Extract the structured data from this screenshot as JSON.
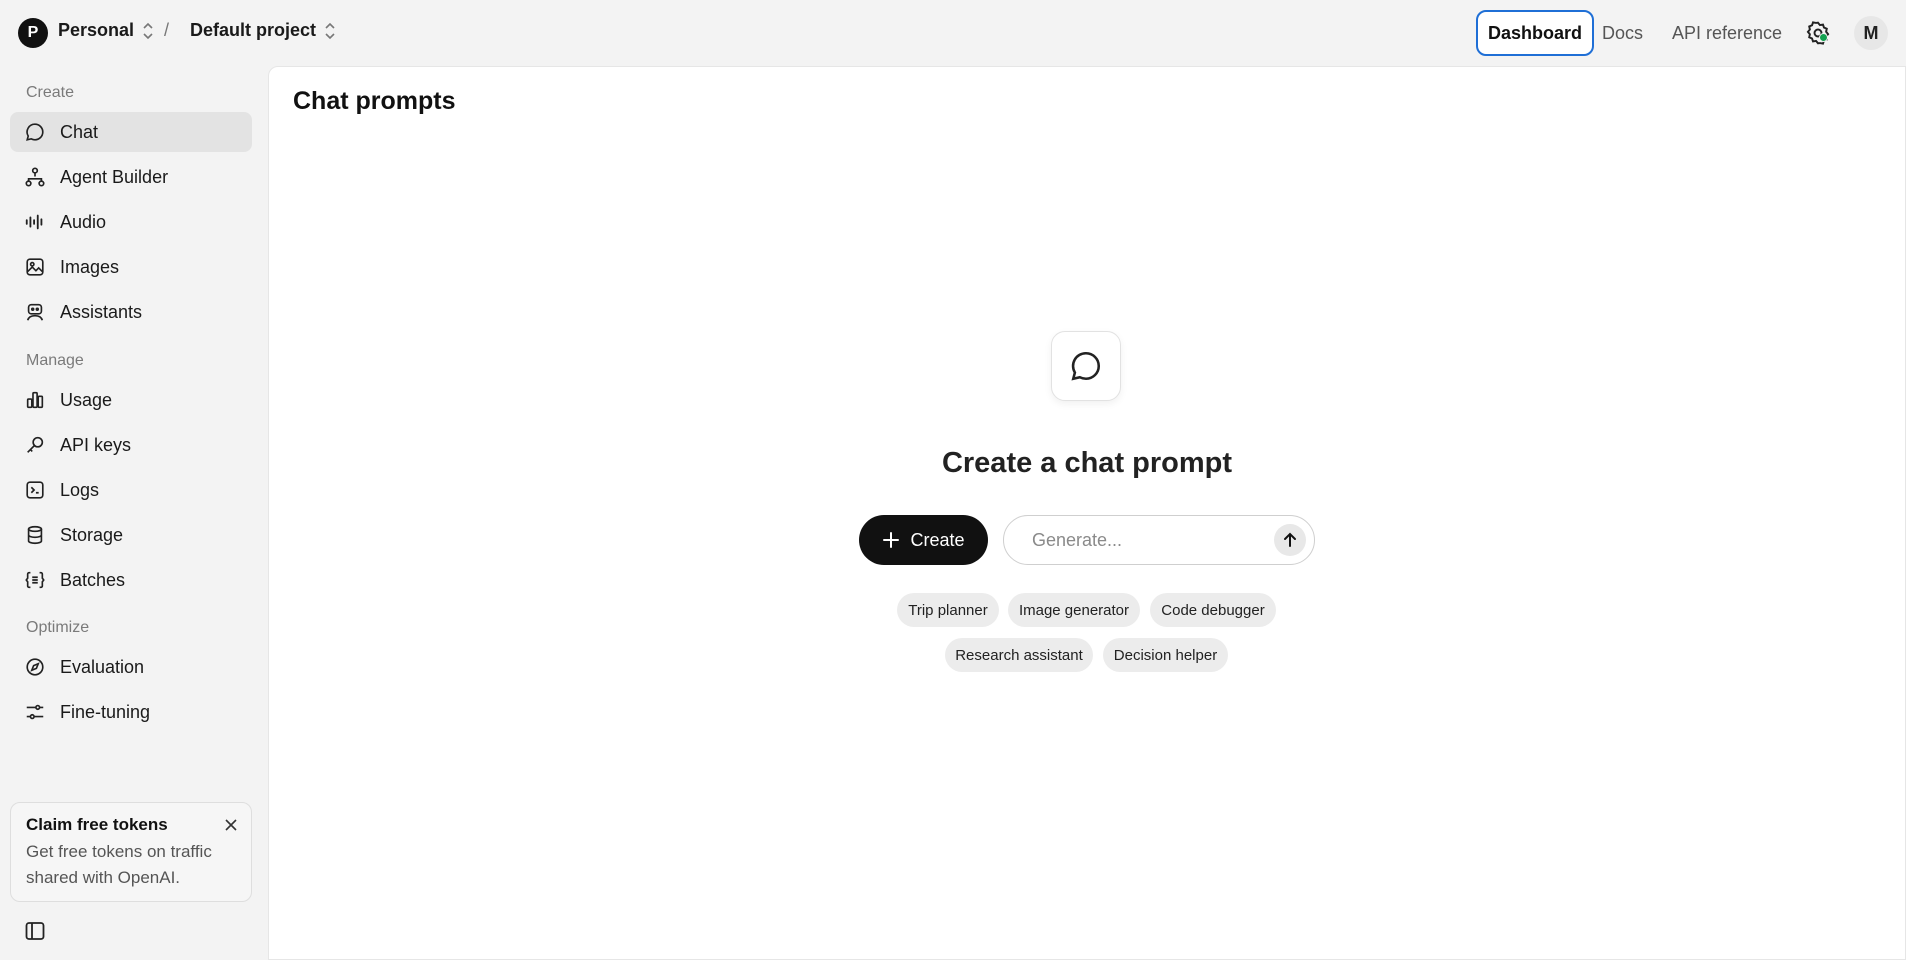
{
  "topbar": {
    "org_initial": "P",
    "org_name": "Personal",
    "separator": "/",
    "project_name": "Default project",
    "links": {
      "dashboard": "Dashboard",
      "docs": "Docs",
      "api_reference": "API reference"
    },
    "user_initial": "M"
  },
  "sidebar": {
    "create_label": "Create",
    "create_items": [
      {
        "label": "Chat",
        "icon": "chat-bubble-icon"
      },
      {
        "label": "Agent Builder",
        "icon": "flow-icon"
      },
      {
        "label": "Audio",
        "icon": "waveform-icon"
      },
      {
        "label": "Images",
        "icon": "image-icon"
      },
      {
        "label": "Assistants",
        "icon": "robot-icon"
      }
    ],
    "manage_label": "Manage",
    "manage_items": [
      {
        "label": "Usage",
        "icon": "bar-chart-icon"
      },
      {
        "label": "API keys",
        "icon": "key-icon"
      },
      {
        "label": "Logs",
        "icon": "terminal-icon"
      },
      {
        "label": "Storage",
        "icon": "database-icon"
      },
      {
        "label": "Batches",
        "icon": "braces-list-icon"
      }
    ],
    "optimize_label": "Optimize",
    "optimize_items": [
      {
        "label": "Evaluation",
        "icon": "compass-icon"
      },
      {
        "label": "Fine-tuning",
        "icon": "sliders-icon"
      }
    ],
    "promo": {
      "title": "Claim free tokens",
      "text": "Get free tokens on traffic shared with OpenAI."
    }
  },
  "main": {
    "title": "Chat prompts",
    "empty_title": "Create a chat prompt",
    "create_label": "Create",
    "generate_placeholder": "Generate...",
    "suggestions": [
      "Trip planner",
      "Image generator",
      "Code debugger",
      "Research assistant",
      "Decision helper"
    ]
  },
  "colors": {
    "accent_border": "#1f6fd6",
    "status_dot": "#12a150",
    "primary_button": "#111111"
  }
}
